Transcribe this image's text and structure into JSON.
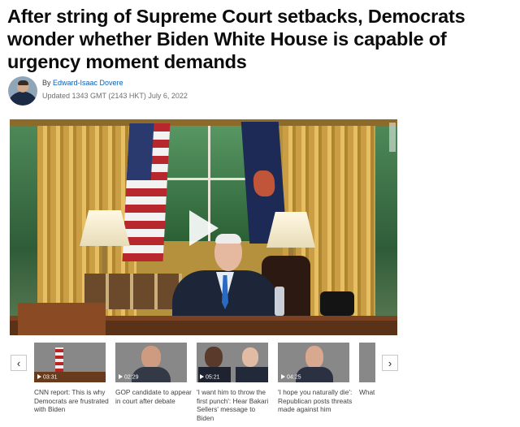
{
  "article": {
    "headline": "After string of Supreme Court setbacks, Democrats wonder whether Biden White House is capable of urgency moment demands",
    "byline_prefix": "By",
    "author": "Edward-Isaac Dovere",
    "updated": "Updated 1343 GMT (2143 HKT) July 6, 2022"
  },
  "carousel": {
    "prev_icon": "chevron-left-icon",
    "next_icon": "chevron-right-icon",
    "prev_label": "‹",
    "next_label": "›",
    "items": [
      {
        "caption": "CNN report: This is why Democrats are frustrated with Biden",
        "duration": "03:31"
      },
      {
        "caption": "GOP candidate to appear in court after debate",
        "duration": "02:29"
      },
      {
        "caption": "'I want him to throw the first punch': Hear Bakari Sellers' message to Biden",
        "duration": "05:21"
      },
      {
        "caption": "'I hope you naturally die': Republican posts threats made against him",
        "duration": "04:25"
      },
      {
        "caption": "What subp Georg",
        "duration": ""
      }
    ]
  }
}
